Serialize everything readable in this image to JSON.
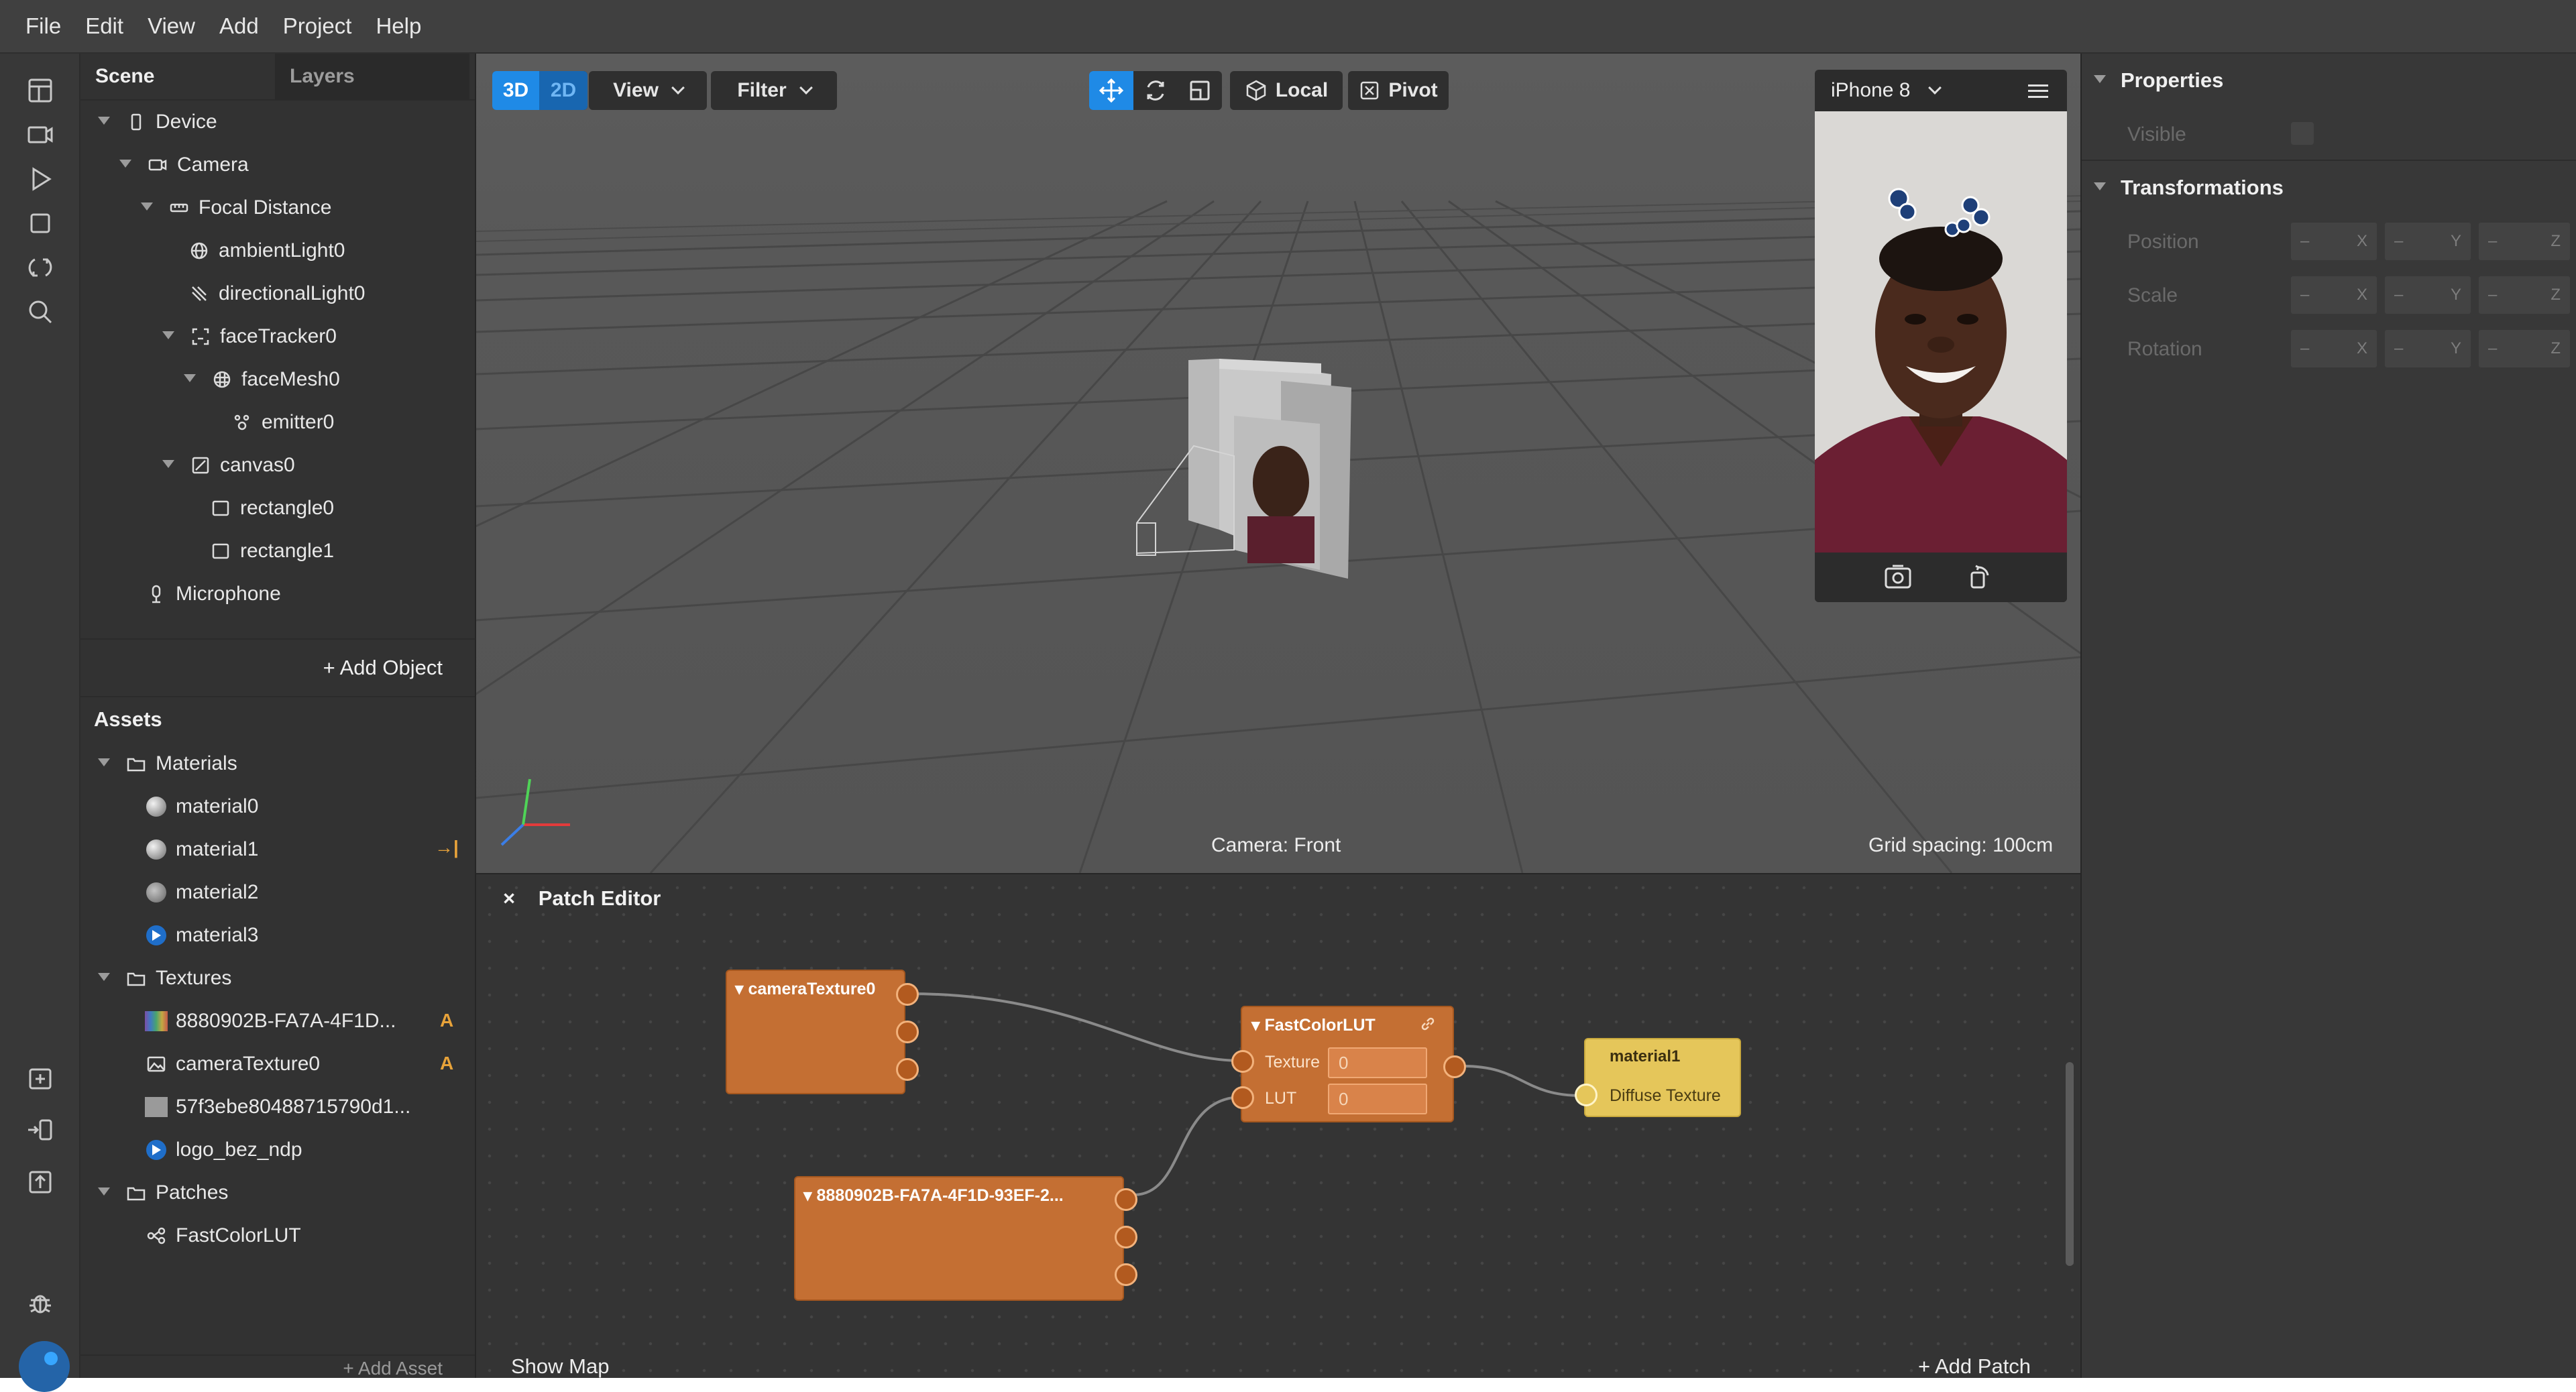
{
  "menu": {
    "items": [
      "File",
      "Edit",
      "View",
      "Add",
      "Project",
      "Help"
    ]
  },
  "scene_panel": {
    "tab_scene": "Scene",
    "tab_layers": "Layers",
    "tree": [
      {
        "label": "Device",
        "icon": "device-icon"
      },
      {
        "label": "Camera",
        "icon": "camera-icon"
      },
      {
        "label": "Focal Distance",
        "icon": "focal-distance-icon"
      },
      {
        "label": "ambientLight0",
        "icon": "ambient-light-icon"
      },
      {
        "label": "directionalLight0",
        "icon": "directional-light-icon"
      },
      {
        "label": "faceTracker0",
        "icon": "face-tracker-icon"
      },
      {
        "label": "faceMesh0",
        "icon": "face-mesh-icon"
      },
      {
        "label": "emitter0",
        "icon": "emitter-icon"
      },
      {
        "label": "canvas0",
        "icon": "canvas-icon"
      },
      {
        "label": "rectangle0",
        "icon": "rectangle-icon"
      },
      {
        "label": "rectangle1",
        "icon": "rectangle-icon"
      },
      {
        "label": "Microphone",
        "icon": "microphone-icon"
      }
    ],
    "add_object": "+ Add Object",
    "assets_title": "Assets",
    "assets": [
      {
        "label": "Materials",
        "icon": "folder-icon"
      },
      {
        "label": "material0",
        "icon": "material-sphere-icon"
      },
      {
        "label": "material1",
        "icon": "material-sphere-icon",
        "badge": "→|"
      },
      {
        "label": "material2",
        "icon": "material-texture-icon"
      },
      {
        "label": "material3",
        "icon": "material-blue-icon"
      },
      {
        "label": "Textures",
        "icon": "folder-icon"
      },
      {
        "label": "8880902B-FA7A-4F1D...",
        "icon": "texture-gradient-icon",
        "badge": "A"
      },
      {
        "label": "cameraTexture0",
        "icon": "image-icon",
        "badge": "A"
      },
      {
        "label": "57f3ebe80488715790d1...",
        "icon": "texture-gray-icon"
      },
      {
        "label": "logo_bez_ndp",
        "icon": "logo-icon"
      },
      {
        "label": "Patches",
        "icon": "folder-icon"
      },
      {
        "label": "FastColorLUT",
        "icon": "patch-icon"
      }
    ],
    "add_asset": "+ Add Asset"
  },
  "viewport": {
    "btn_3d": "3D",
    "btn_2d": "2D",
    "view": "View",
    "filter": "Filter",
    "local": "Local",
    "pivot": "Pivot",
    "camera_label": "Camera: Front",
    "grid_label": "Grid spacing: 100cm"
  },
  "phone_preview": {
    "device": "iPhone 8"
  },
  "properties": {
    "properties_title": "Properties",
    "visible_label": "Visible",
    "transformations_title": "Transformations",
    "position_label": "Position",
    "scale_label": "Scale",
    "rotation_label": "Rotation",
    "axis_x": "X",
    "axis_y": "Y",
    "axis_z": "Z",
    "dash": "–"
  },
  "patch_editor": {
    "close": "×",
    "title": "Patch Editor",
    "node_camera": "cameraTexture0",
    "node_texture": "8880902B-FA7A-4F1D-93EF-2...",
    "node_lut": "FastColorLUT",
    "lut_texture_label": "Texture",
    "lut_texture_value": "0",
    "lut_lut_label": "LUT",
    "lut_lut_value": "0",
    "node_material": "material1",
    "material_port": "Diffuse Texture",
    "show_map": "Show Map",
    "add_patch": "+ Add Patch"
  },
  "colors": {
    "accent": "#1f8ae6",
    "patch_orange": "#c46f33",
    "material_yellow": "#e5c65a",
    "badge_orange": "#e8a33a"
  }
}
